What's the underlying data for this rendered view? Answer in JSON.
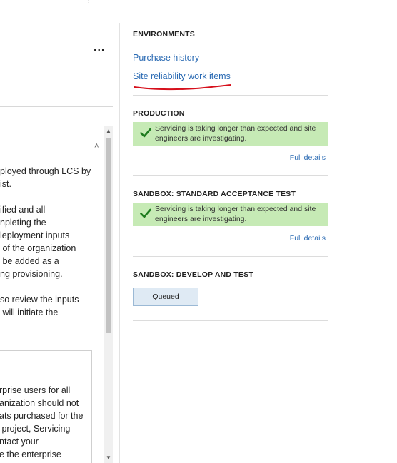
{
  "left_panel": {
    "top_cut_text": "',",
    "more_menu_glyph": "...",
    "collapse_glyph": "˄",
    "text_block_1": "ployed through LCS by\nist.",
    "text_block_2": "ified and all\nnpleting the\nleployment inputs\n of the organization\n be added as a\nng provisioning.",
    "text_block_3": "so review the inputs\n will initiate the",
    "inner_box_text": "rprise users for all\nanization should not\nats purchased for the\n project, Servicing\nntact your\ne the enterprise\nprojects. Subscription",
    "scroll_up_glyph": "▲",
    "scroll_down_glyph": "▼"
  },
  "environments": {
    "heading": "ENVIRONMENTS",
    "links": {
      "purchase_history": "Purchase history",
      "site_reliability": "Site reliability work items"
    }
  },
  "production": {
    "heading": "PRODUCTION",
    "status": "Servicing is taking longer than expected and site engineers are investigating.",
    "details_link": "Full details"
  },
  "sandbox_uat": {
    "heading": "SANDBOX: STANDARD ACCEPTANCE TEST",
    "status": "Servicing is taking longer than expected and site engineers are investigating.",
    "details_link": "Full details"
  },
  "sandbox_dev": {
    "heading": "SANDBOX: DEVELOP AND TEST",
    "button_label": "Queued"
  },
  "colors": {
    "link": "#2a6ab3",
    "status_bg": "#c6eab5",
    "check": "#1e7b1e",
    "annotation": "#d6101c",
    "button_bg": "#dfeaf4"
  },
  "icons": {
    "status_icon": "checkmark-icon",
    "more_icon": "ellipsis-icon",
    "collapse_icon": "chevron-up-icon"
  }
}
